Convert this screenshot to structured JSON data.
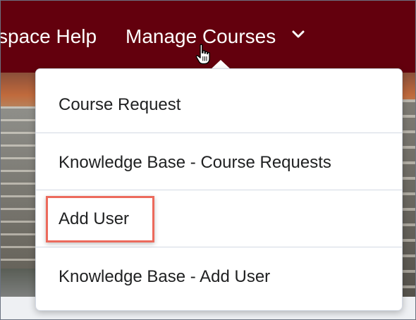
{
  "nav": {
    "items": [
      {
        "label": "space Help"
      },
      {
        "label": "Manage Courses"
      }
    ]
  },
  "dropdown": {
    "items": [
      {
        "label": "Course Request"
      },
      {
        "label": "Knowledge Base - Course Requests"
      },
      {
        "label": "Add User"
      },
      {
        "label": "Knowledge Base - Add User"
      }
    ]
  },
  "colors": {
    "nav_background": "#63000d",
    "nav_text": "#ffffff",
    "menu_background": "#ffffff",
    "menu_text": "#202122",
    "highlight_border": "#ec6a5c"
  },
  "icons": {
    "chevron": "chevron-down-icon",
    "cursor": "hand-pointer-icon"
  }
}
